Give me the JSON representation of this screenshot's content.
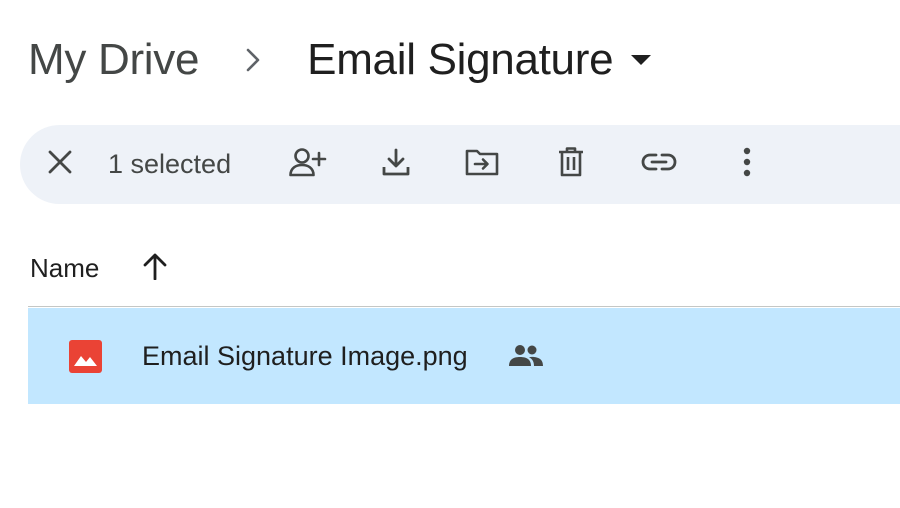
{
  "breadcrumb": {
    "root_label": "My Drive",
    "separator_icon": "chevron-right-icon",
    "current_label": "Email Signature",
    "current_caret_icon": "caret-down-icon"
  },
  "toolbar": {
    "clear_icon": "close-icon",
    "selected_count_label": "1 selected",
    "actions": [
      {
        "name": "share",
        "icon": "add-person-icon"
      },
      {
        "name": "download",
        "icon": "download-icon"
      },
      {
        "name": "move",
        "icon": "move-to-folder-icon"
      },
      {
        "name": "delete",
        "icon": "trash-icon"
      },
      {
        "name": "copy-link",
        "icon": "link-icon"
      },
      {
        "name": "more-actions",
        "icon": "more-vert-icon"
      }
    ]
  },
  "list": {
    "header": {
      "name_label": "Name",
      "sort_icon": "arrow-up-icon"
    },
    "rows": [
      {
        "file_name": "Email Signature Image.png",
        "type_icon": "image-file-icon",
        "shared_icon": "shared-people-icon",
        "selected": true
      }
    ]
  },
  "colors": {
    "toolbar_bg": "#eef2f8",
    "selected_row_bg": "#c2e7ff",
    "image_icon_red": "#ea4335",
    "icon_dark": "#444746",
    "text_primary": "#1f1f1f"
  }
}
